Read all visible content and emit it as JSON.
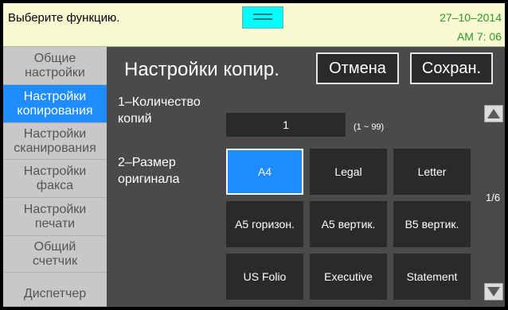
{
  "status": {
    "message": "Выберите функцию.",
    "date": "27–10–2014",
    "time": "AM 7: 06"
  },
  "sidebar": {
    "items": [
      {
        "label_line1": "Общие",
        "label_line2": "настройки",
        "active": false
      },
      {
        "label_line1": "Настройки",
        "label_line2": "копирования",
        "active": true
      },
      {
        "label_line1": "Настройки",
        "label_line2": "сканирования",
        "active": false
      },
      {
        "label_line1": "Настройки",
        "label_line2": "факса",
        "active": false
      },
      {
        "label_line1": "Настройки",
        "label_line2": "печати",
        "active": false
      },
      {
        "label_line1": "Общий",
        "label_line2": "счетчик",
        "active": false
      },
      {
        "label_line1": "Диспетчер",
        "label_line2": "",
        "active": false
      }
    ]
  },
  "header": {
    "title": "Настройки копир.",
    "cancel_label": "Отмена",
    "save_label": "Сохран."
  },
  "settings": {
    "copies_label_line1": "1–Количество",
    "copies_label_line2": "копий",
    "copies_value": "1",
    "copies_range": "(1 ~ 99)",
    "size_label_line1": "2–Размер",
    "size_label_line2": "оригинала",
    "sizes": [
      "A4",
      "Legal",
      "Letter",
      "A5 горизон.",
      "A5 вертик.",
      "B5 вертик.",
      "US Folio",
      "Executive",
      "Statement"
    ],
    "selected_size": "A4"
  },
  "pager": {
    "page_indicator": "1/6",
    "up_icon": "triangle-up-icon",
    "down_icon": "triangle-down-icon"
  },
  "colors": {
    "accent": "#1f8cff",
    "status_bar": "#fafad2",
    "status_text_time": "#2a9a2a",
    "handle": "#00ffff"
  }
}
